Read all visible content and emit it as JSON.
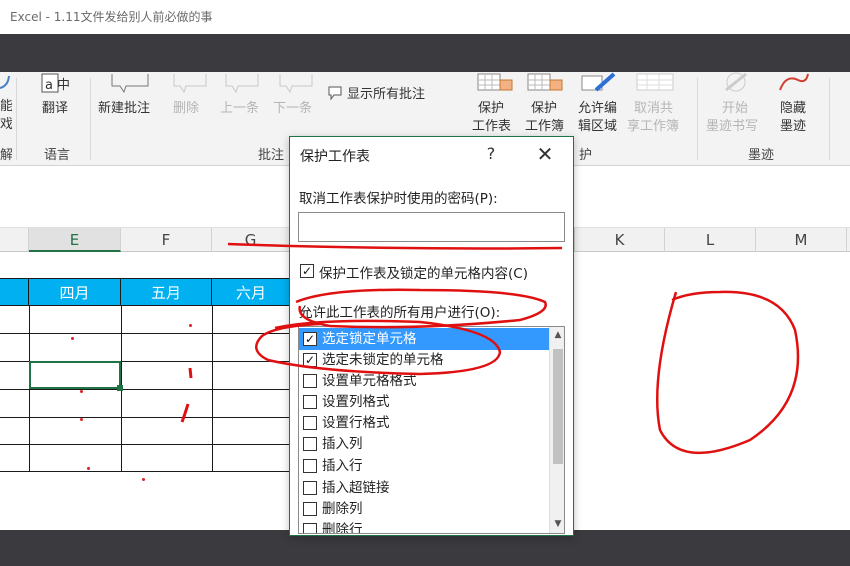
{
  "window": {
    "title": "Excel - 1.11文件发给别人前必做的事"
  },
  "ribbon": {
    "partial_left": [
      "能",
      "戏",
      "解"
    ],
    "translate_label": "翻译",
    "language_group": "语言",
    "new_comment": "新建批注",
    "delete": "删除",
    "prev": "上一条",
    "next": "下一条",
    "show_all": "显示所有批注",
    "comments_group": "批注",
    "protect_sheet": [
      "保护",
      "工作表"
    ],
    "protect_workbook": [
      "保护",
      "工作簿"
    ],
    "allow_edit": [
      "允许编",
      "辑区域"
    ],
    "unshare": [
      "取消共",
      "享工作簿"
    ],
    "protect_group_partial": "护",
    "start_ink": [
      "开始",
      "墨迹书写"
    ],
    "hide_ink": [
      "隐藏",
      "墨迹"
    ],
    "ink_group": "墨迹"
  },
  "sheet": {
    "columns": [
      "E",
      "F",
      "G",
      "K",
      "L",
      "M"
    ],
    "header_cells": [
      "四月",
      "五月",
      "六月"
    ]
  },
  "dialog": {
    "title": "保护工作表",
    "help": "?",
    "close": "✕",
    "password_label": "取消工作表保护时使用的密码(P):",
    "protect_check_label": "保护工作表及锁定的单元格内容(C)",
    "allow_label": "允许此工作表的所有用户进行(O):",
    "options": [
      {
        "label": "选定锁定单元格",
        "checked": true,
        "selected": true
      },
      {
        "label": "选定未锁定的单元格",
        "checked": true,
        "selected": false
      },
      {
        "label": "设置单元格格式",
        "checked": false,
        "selected": false
      },
      {
        "label": "设置列格式",
        "checked": false,
        "selected": false
      },
      {
        "label": "设置行格式",
        "checked": false,
        "selected": false
      },
      {
        "label": "插入列",
        "checked": false,
        "selected": false
      },
      {
        "label": "插入行",
        "checked": false,
        "selected": false
      },
      {
        "label": "插入超链接",
        "checked": false,
        "selected": false
      },
      {
        "label": "删除列",
        "checked": false,
        "selected": false
      },
      {
        "label": "删除行",
        "checked": false,
        "selected": false
      }
    ]
  },
  "colors": {
    "accent": "#217346",
    "header_fill": "#00b0f0",
    "ink": "#e01010",
    "selection": "#3399ff"
  }
}
